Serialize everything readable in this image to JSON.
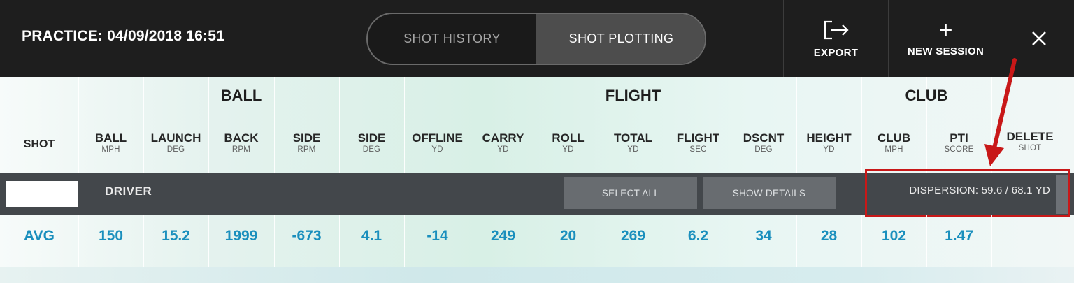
{
  "header": {
    "session_title": "PRACTICE: 04/09/2018 16:51",
    "tabs": [
      "SHOT HISTORY",
      "SHOT PLOTTING"
    ],
    "active_tab": "SHOT PLOTTING",
    "export_label": "EXPORT",
    "new_session_label": "NEW SESSION",
    "export_icon": "export-icon",
    "new_session_icon": "plus-icon",
    "close_icon": "close-icon"
  },
  "table": {
    "groups": [
      "BALL",
      "FLIGHT",
      "CLUB"
    ],
    "shot_header": "SHOT",
    "columns": [
      {
        "label": "BALL",
        "unit": "MPH"
      },
      {
        "label": "LAUNCH",
        "unit": "DEG"
      },
      {
        "label": "BACK",
        "unit": "RPM"
      },
      {
        "label": "SIDE",
        "unit": "RPM"
      },
      {
        "label": "SIDE",
        "unit": "DEG"
      },
      {
        "label": "OFFLINE",
        "unit": "YD"
      },
      {
        "label": "CARRY",
        "unit": "YD"
      },
      {
        "label": "ROLL",
        "unit": "YD"
      },
      {
        "label": "TOTAL",
        "unit": "YD"
      },
      {
        "label": "FLIGHT",
        "unit": "SEC"
      },
      {
        "label": "DSCNT",
        "unit": "DEG"
      },
      {
        "label": "HEIGHT",
        "unit": "YD"
      },
      {
        "label": "CLUB",
        "unit": "MPH"
      },
      {
        "label": "PTI",
        "unit": "SCORE"
      },
      {
        "label": "DELETE",
        "unit": "SHOT"
      }
    ],
    "club_row": {
      "club_name": "DRIVER",
      "select_all_label": "SELECT ALL",
      "show_details_label": "SHOW DETAILS",
      "dispersion_text": "DISPERSION: 59.6 / 68.1 YD"
    },
    "avg_row": {
      "label": "AVG",
      "values": [
        "150",
        "15.2",
        "1999",
        "-673",
        "4.1",
        "-14",
        "249",
        "20",
        "269",
        "6.2",
        "34",
        "28",
        "102",
        "1.47"
      ]
    }
  },
  "colors": {
    "header_bg": "#1e1e1e",
    "active_tab_bg": "#4d4d4d",
    "club_row_bg": "#43474b",
    "avg_value": "#1a8fbd",
    "annotation": "#c81818"
  }
}
